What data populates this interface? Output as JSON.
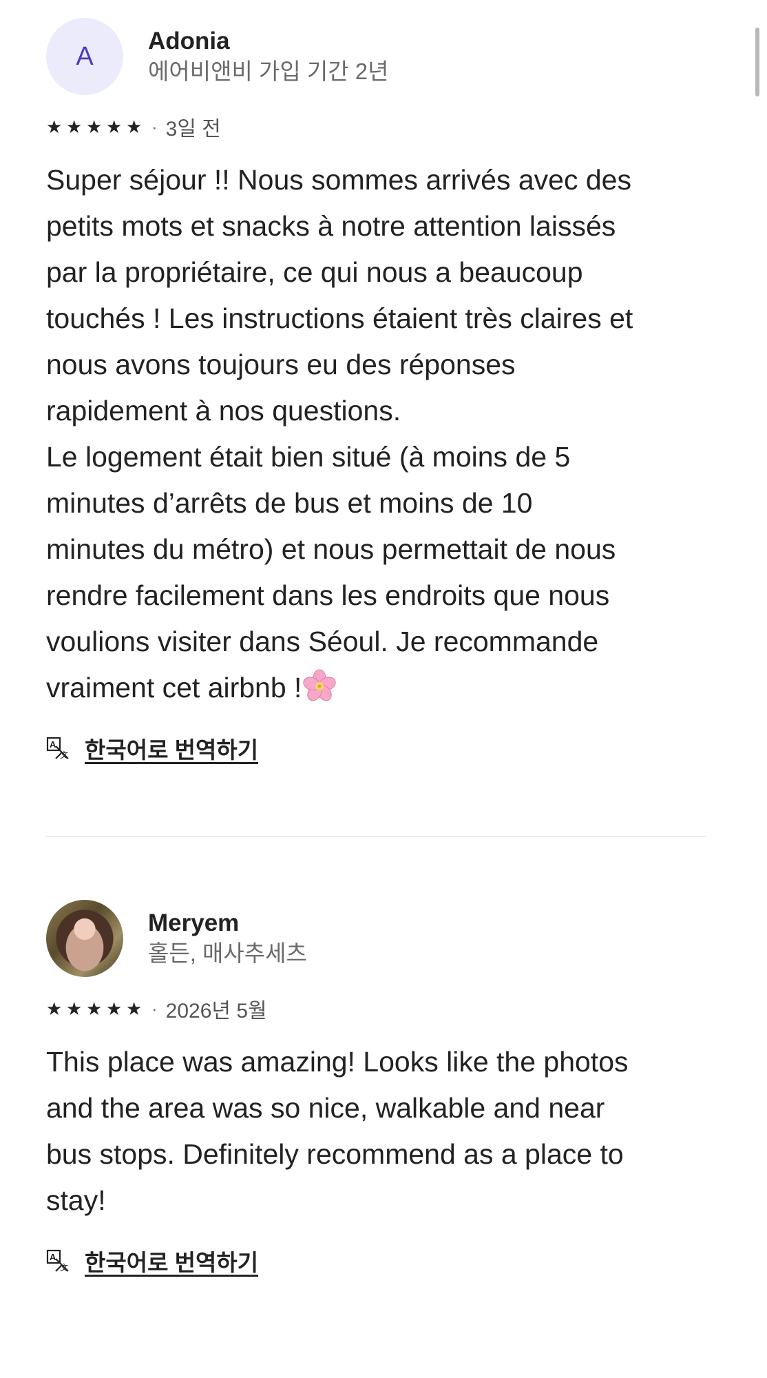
{
  "reviews": [
    {
      "avatar_initial": "A",
      "name": "Adonia",
      "subtitle": "에어비앤비 가입 기간 2년",
      "rating": 5,
      "date": "3일 전",
      "body": "Super séjour !! Nous sommes arrivés avec des\npetits mots et snacks à notre attention laissés\npar la propriétaire, ce qui nous a beaucoup\ntouchés ! Les instructions étaient très claires et\nnous avons toujours eu des réponses\nrapidement à nos questions.\nLe logement était bien situé (à moins de 5\nminutes d’arrêts de bus et moins de 10\nminutes du métro) et nous permettait de nous\nrendre facilement dans les endroits que nous\nvoulions visiter dans Séoul. Je recommande\nvraiment cet airbnb !",
      "body_emoji": "cherry-blossom-icon",
      "translate_label": "한국어로 번역하기"
    },
    {
      "name": "Meryem",
      "subtitle": "홀든, 매사추세츠",
      "rating": 5,
      "date": "2026년 5월",
      "body": "This place was amazing! Looks like the photos\nand the area was so nice, walkable and near\nbus stops. Definitely recommend as a place to\nstay!",
      "translate_label": "한국어로 번역하기"
    }
  ],
  "icons": {
    "star": "star-icon",
    "translate": "translate-icon"
  },
  "colors": {
    "text": "#222222",
    "secondary": "#6a6a6a",
    "avatar_bg": "#ecebfb",
    "avatar_initial": "#4b3cc0"
  }
}
